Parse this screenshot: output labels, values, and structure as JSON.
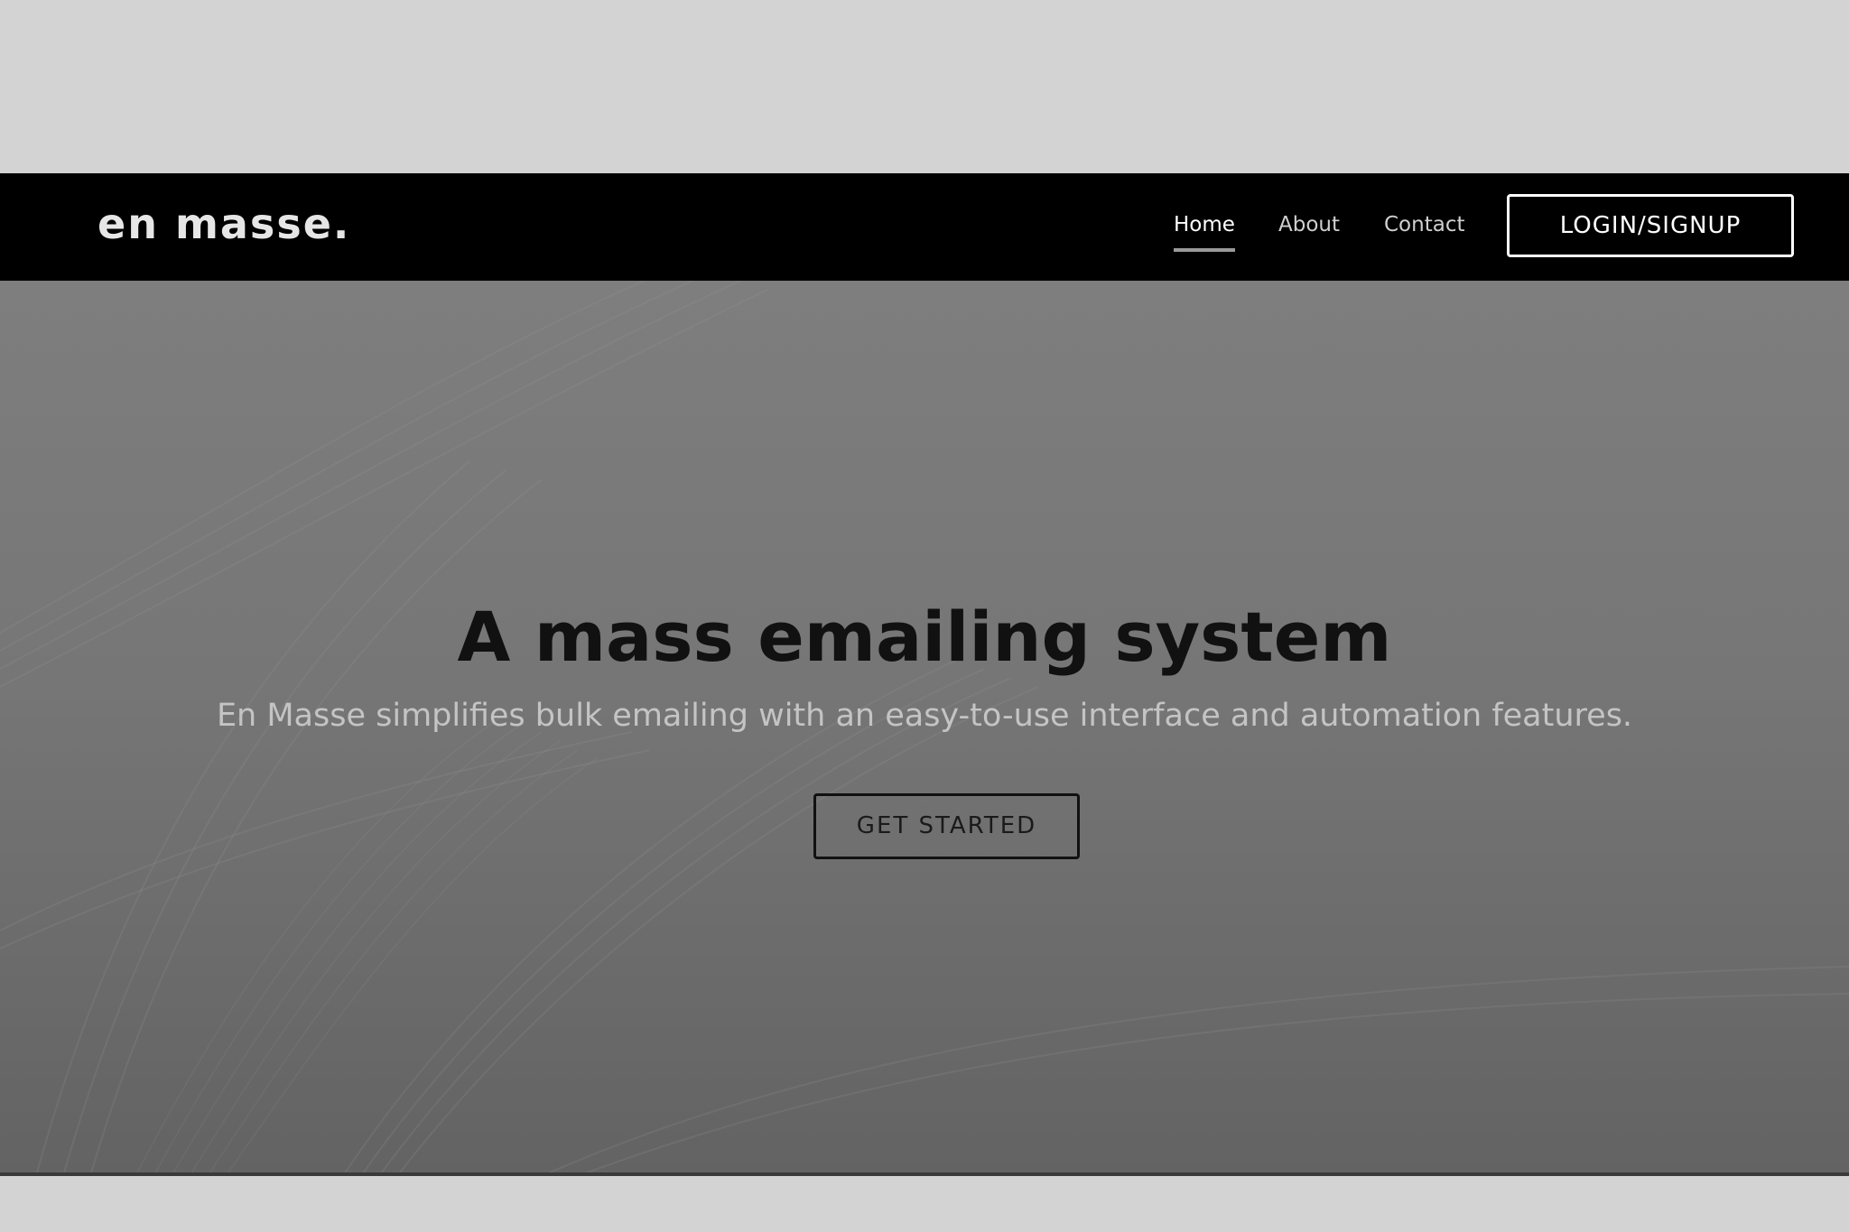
{
  "navbar": {
    "brand": "en masse.",
    "links": [
      {
        "label": "Home",
        "active": true
      },
      {
        "label": "About",
        "active": false
      },
      {
        "label": "Contact",
        "active": false
      }
    ],
    "login_label": "LOGIN/SIGNUP"
  },
  "hero": {
    "title": "A mass emailing system",
    "subtitle": "En Masse simplifies bulk emailing with an easy-to-use interface and automation features.",
    "cta_label": "GET STARTED"
  },
  "colors": {
    "page_background": "#d3d3d3",
    "navbar_background": "#000000",
    "hero_background": "#777777",
    "title_text": "#111111",
    "subtitle_text": "#c4c4c4"
  }
}
